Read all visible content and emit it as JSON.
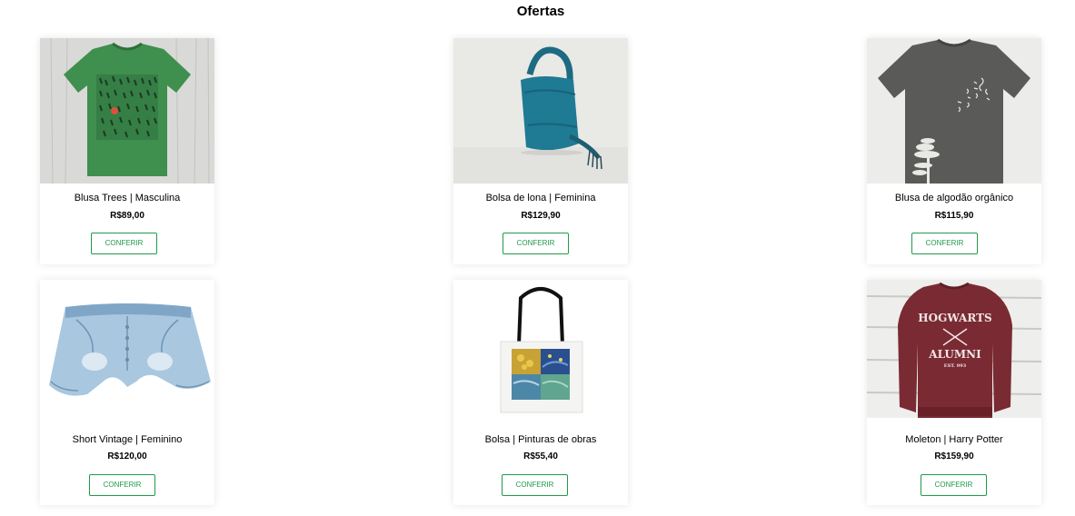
{
  "page": {
    "title": "Ofertas"
  },
  "products": [
    {
      "name": "Blusa Trees | Masculina",
      "price": "R$89,00",
      "button": "CONFERIR",
      "image": "green-tshirt-trees"
    },
    {
      "name": "Bolsa de lona | Feminina",
      "price": "R$129,90",
      "button": "CONFERIR",
      "image": "teal-canvas-bag"
    },
    {
      "name": "Blusa de algodão orgânico",
      "price": "R$115,90",
      "button": "CONFERIR",
      "image": "gray-tshirt-tree-print"
    },
    {
      "name": "Short Vintage | Feminino",
      "price": "R$120,00",
      "button": "CONFERIR",
      "image": "denim-shorts"
    },
    {
      "name": "Bolsa | Pinturas de obras",
      "price": "R$55,40",
      "button": "CONFERIR",
      "image": "tote-bag-paintings"
    },
    {
      "name": "Moleton | Harry Potter",
      "price": "R$159,90",
      "button": "CONFERIR",
      "image": "maroon-sweatshirt"
    }
  ],
  "colors": {
    "accent": "#1f9a4a"
  }
}
